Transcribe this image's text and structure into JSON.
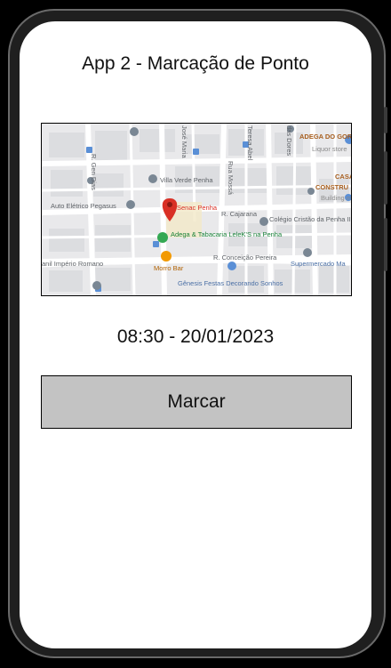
{
  "app": {
    "title": "App 2 - Marcação de Ponto"
  },
  "map": {
    "places": {
      "adega_gorduras": "ADEGA DO GORDURAS",
      "liquor_store": "Liquor store",
      "villa_verde": "Villa Verde Penha",
      "auto_eletrico": "Auto Elétrico Pegasus",
      "senac": "Senac Penha",
      "colegio": "Colégio Cristão da Penha II",
      "adega_tabacaria": "Adega & Tabacaria LeleK'S na Penha",
      "morro_bar": "Morro Bar",
      "imperio": "anil Império Romano",
      "supermercado": "Supermercado Ma",
      "genesis": "Gênesis Festas Decorando Sonhos",
      "casa": "CASA",
      "constru": "CONSTRU",
      "building": "Building materi"
    },
    "streets": {
      "gen_dias": "R. Gen Dias",
      "jose_maria": "José Maria",
      "teresa": "Teresa Abel",
      "mossa": "Rua Mossá",
      "das_dores": "das Dores",
      "cajarana": "R. Cajarana",
      "conceicao": "R. Conceição Pereira"
    },
    "accent_pin": "#d93025",
    "accent_green": "#34a853",
    "accent_orange": "#f29900"
  },
  "clock": {
    "datetime": "08:30 - 20/01/2023"
  },
  "actions": {
    "mark_label": "Marcar"
  }
}
